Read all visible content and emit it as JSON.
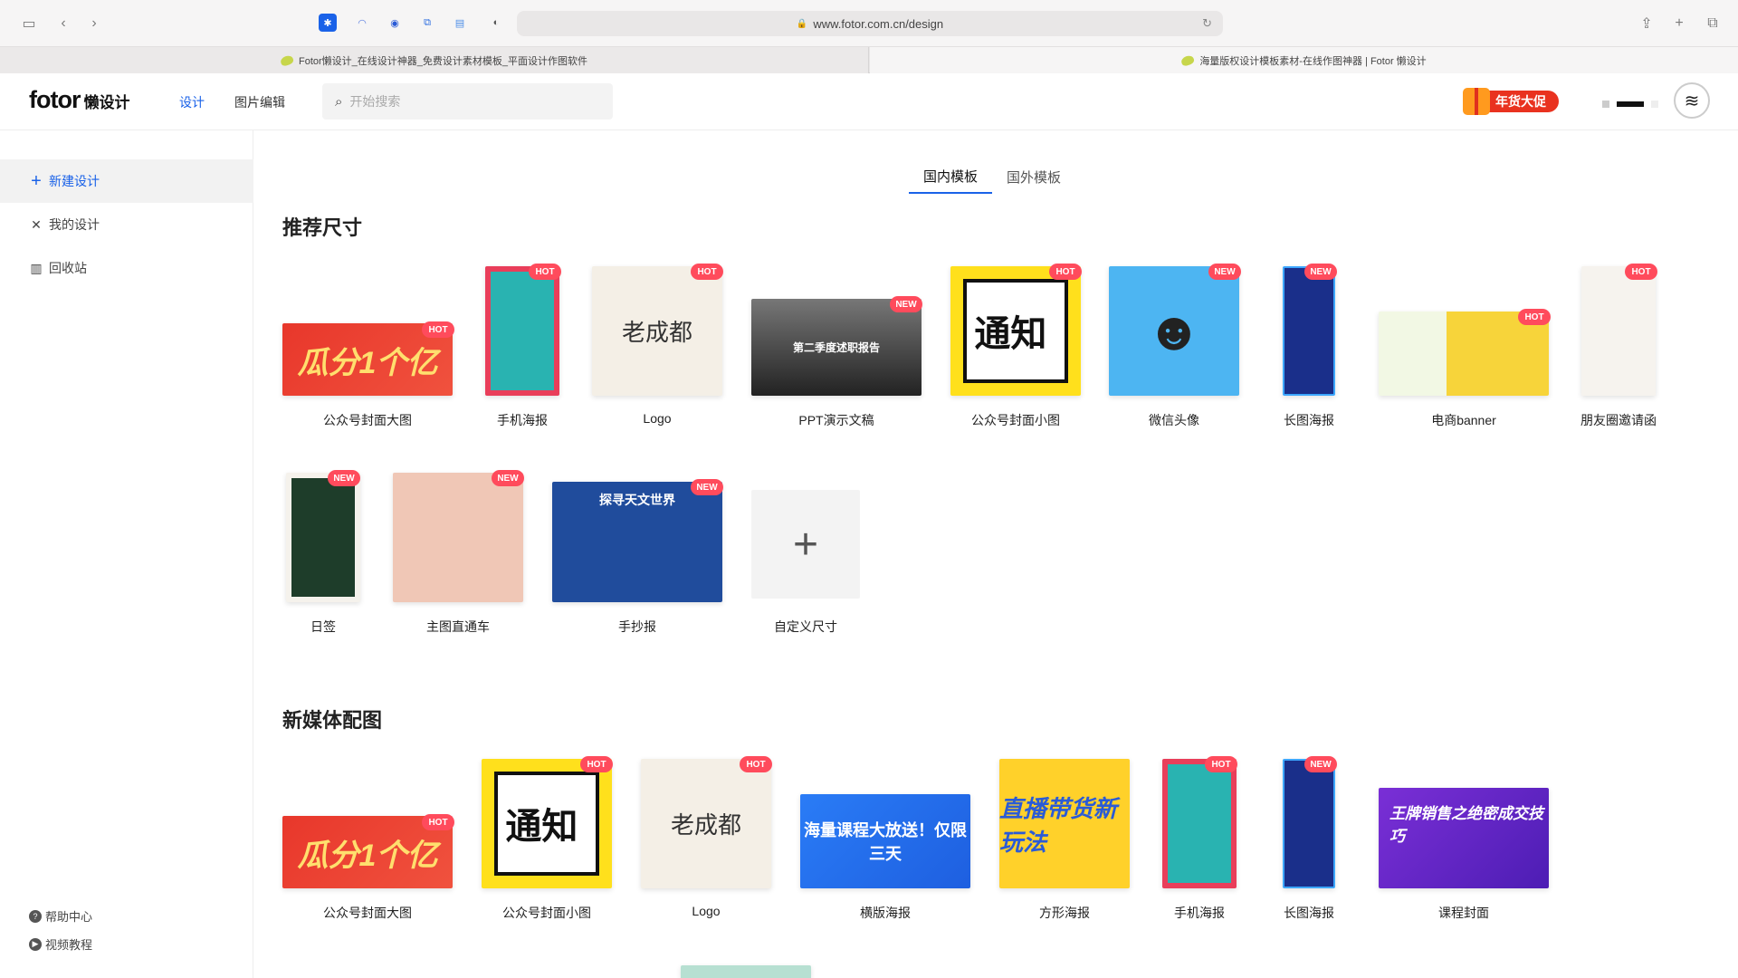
{
  "browser": {
    "url": "www.fotor.com.cn/design",
    "tabs": [
      {
        "title": "Fotor懒设计_在线设计神器_免费设计素材模板_平面设计作图软件"
      },
      {
        "title": "海量版权设计模板素材-在线作图神器 | Fotor 懒设计"
      }
    ]
  },
  "header": {
    "logo_en": "fotor",
    "logo_cn": "懒设计",
    "nav": [
      {
        "label": "设计"
      },
      {
        "label": "图片编辑"
      }
    ],
    "search_placeholder": "开始搜索",
    "promo_label": "年货大促"
  },
  "sidebar": {
    "items": [
      {
        "label": "新建设计"
      },
      {
        "label": "我的设计"
      },
      {
        "label": "回收站"
      }
    ],
    "footer": [
      {
        "label": "帮助中心"
      },
      {
        "label": "视频教程"
      }
    ]
  },
  "main": {
    "tabs": [
      {
        "label": "国内模板",
        "active": true
      },
      {
        "label": "国外模板",
        "active": false
      }
    ],
    "sections": [
      {
        "title": "推荐尺寸",
        "cards": [
          {
            "label": "公众号封面大图",
            "badge": "HOT",
            "thumb_text": "瓜分1个亿"
          },
          {
            "label": "手机海报",
            "badge": "HOT"
          },
          {
            "label": "Logo",
            "badge": "HOT",
            "thumb_text": "老成都"
          },
          {
            "label": "PPT演示文稿",
            "badge": "NEW",
            "thumb_text": "第二季度述职报告"
          },
          {
            "label": "公众号封面小图",
            "badge": "HOT",
            "thumb_text": "通知"
          },
          {
            "label": "微信头像",
            "badge": "NEW"
          },
          {
            "label": "长图海报",
            "badge": "NEW"
          },
          {
            "label": "电商banner",
            "badge": "HOT"
          },
          {
            "label": "朋友圈邀请函",
            "badge": "HOT"
          },
          {
            "label": "日签",
            "badge": "NEW"
          },
          {
            "label": "主图直通车",
            "badge": "NEW"
          },
          {
            "label": "手抄报",
            "badge": "NEW",
            "thumb_text": "探寻天文世界"
          },
          {
            "label": "自定义尺寸",
            "badge": ""
          }
        ]
      },
      {
        "title": "新媒体配图",
        "cards": [
          {
            "label": "公众号封面大图",
            "badge": "HOT",
            "thumb_text": "瓜分1个亿"
          },
          {
            "label": "公众号封面小图",
            "badge": "HOT",
            "thumb_text": "通知"
          },
          {
            "label": "Logo",
            "badge": "HOT",
            "thumb_text": "老成都"
          },
          {
            "label": "横版海报",
            "badge": "",
            "thumb_text": "海量课程大放送！仅限三天"
          },
          {
            "label": "方形海报",
            "badge": "",
            "thumb_text": "直播带货新玩法"
          },
          {
            "label": "手机海报",
            "badge": "HOT"
          },
          {
            "label": "长图海报",
            "badge": "NEW"
          },
          {
            "label": "课程封面",
            "badge": "",
            "thumb_text": "王牌销售之绝密成交技巧"
          }
        ]
      }
    ]
  }
}
